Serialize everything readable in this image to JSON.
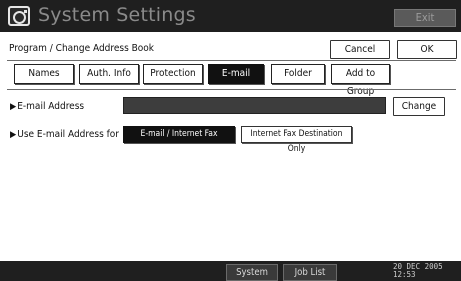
{
  "window": {
    "title": "System Settings",
    "exit_label": "Exit",
    "icon": "settings-app-icon"
  },
  "header": {
    "subtitle": "Program / Change Address Book",
    "cancel_label": "Cancel",
    "ok_label": "OK"
  },
  "tabs": [
    {
      "label": "Names",
      "active": false
    },
    {
      "label": "Auth. Info",
      "active": false
    },
    {
      "label": "Protection",
      "active": false
    },
    {
      "label": "E-mail",
      "active": true
    },
    {
      "label": "Folder",
      "active": false
    },
    {
      "label": "Add to Group",
      "active": false
    }
  ],
  "email": {
    "label": "E-mail Address",
    "value": "",
    "change_label": "Change"
  },
  "use_for": {
    "label": "Use E-mail Address for",
    "options": [
      {
        "label": "E-mail / Internet Fax Destination",
        "selected": true
      },
      {
        "label": "Internet Fax Destination Only",
        "selected": false
      }
    ]
  },
  "status_bar": {
    "system_status_label": "System Status",
    "job_list_label": "Job List",
    "date": "20 DEC  2005",
    "time": "12:53"
  },
  "colors": {
    "titlebar_bg": "#1f1f1f",
    "active_tab_bg": "#111111",
    "field_bg": "#3d3d3d"
  }
}
